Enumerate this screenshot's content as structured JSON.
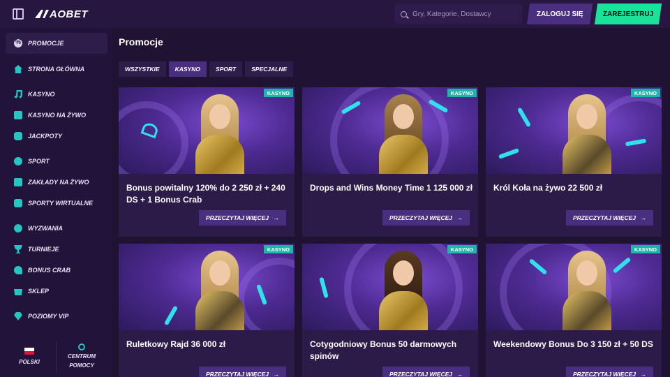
{
  "header": {
    "logo_text": "AOBET",
    "search_placeholder": "Gry, Kategorie, Dostawcy",
    "login_label": "ZALOGUJ SIĘ",
    "register_label": "ZAREJESTRUJ"
  },
  "sidebar": {
    "items": [
      {
        "label": "PROMOCJE",
        "icon": "percent-icon"
      },
      {
        "label": "STRONA GŁÓWNA",
        "icon": "home-icon"
      },
      {
        "label": "KASYNO",
        "icon": "music-note-icon"
      },
      {
        "label": "KASYNO NA ŻYWO",
        "icon": "live-casino-icon"
      },
      {
        "label": "JACKPOTY",
        "icon": "jackpot-icon"
      },
      {
        "label": "SPORT",
        "icon": "ball-icon"
      },
      {
        "label": "ZAKŁADY NA ŻYWO",
        "icon": "live-bets-icon"
      },
      {
        "label": "SPORTY WIRTUALNE",
        "icon": "virtual-sports-icon"
      },
      {
        "label": "WYZWANIA",
        "icon": "challenge-icon"
      },
      {
        "label": "TURNIEJE",
        "icon": "trophy-icon"
      },
      {
        "label": "BONUS CRAB",
        "icon": "crab-icon"
      },
      {
        "label": "SKLEP",
        "icon": "shop-icon"
      },
      {
        "label": "POZIOMY VIP",
        "icon": "diamond-icon"
      }
    ],
    "language_label": "POLSKI",
    "help_label_line1": "CENTRUM",
    "help_label_line2": "POMOCY"
  },
  "main": {
    "title": "Promocje",
    "filters": [
      "WSZYSTKIE",
      "KASYNO",
      "SPORT",
      "SPECJALNE"
    ],
    "active_filter": "KASYNO",
    "cards": [
      {
        "badge": "KASYNO",
        "title": "Bonus powitalny 120% do 2 250 zł + 240 DS + 1 Bonus Crab",
        "button": "PRZECZYTAJ WIĘCEJ"
      },
      {
        "badge": "KASYNO",
        "title": "Drops and Wins Money Time 1 125 000 zł",
        "button": "PRZECZYTAJ WIĘCEJ"
      },
      {
        "badge": "KASYNO",
        "title": "Król Koła na żywo 22 500 zł",
        "button": "PRZECZYTAJ WIĘCEJ"
      },
      {
        "badge": "KASYNO",
        "title": "Ruletkowy Rajd 36 000 zł",
        "button": "PRZECZYTAJ WIĘCEJ"
      },
      {
        "badge": "KASYNO",
        "title": "Cotygodniowy Bonus 50 darmowych spinów",
        "button": "PRZECZYTAJ WIĘCEJ"
      },
      {
        "badge": "KASYNO",
        "title": "Weekendowy Bonus Do 3 150 zł + 50 DS",
        "button": "PRZECZYTAJ WIĘCEJ"
      }
    ]
  },
  "colors": {
    "background": "#1f1233",
    "accent_purple": "#4a2f80",
    "register_green": "#19e39a",
    "badge_teal": "#1fb5a9",
    "icon_teal": "#27c4c2"
  }
}
